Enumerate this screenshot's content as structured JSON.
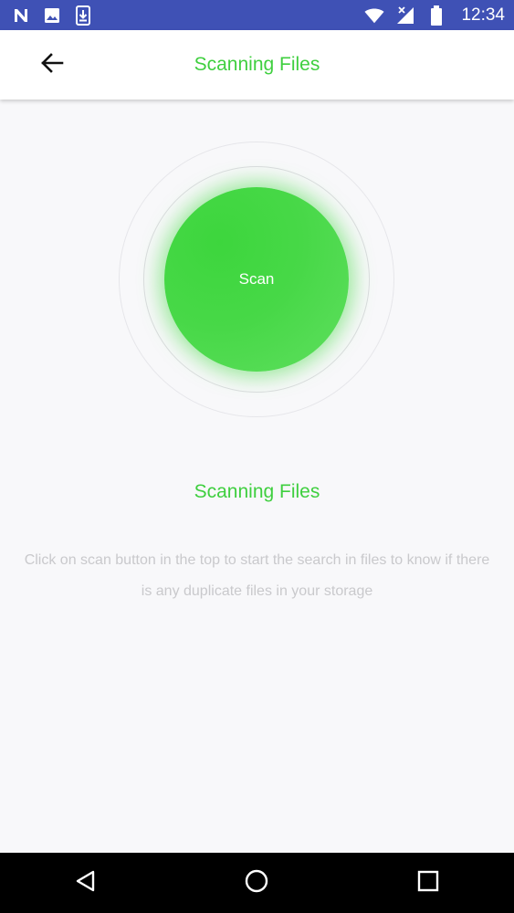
{
  "status_bar": {
    "time": "12:34",
    "icons": [
      "n-logo-icon",
      "image-icon",
      "download-icon",
      "wifi-icon",
      "signal-icon",
      "battery-icon"
    ]
  },
  "app_bar": {
    "title": "Scanning Files",
    "back_icon": "arrow-back-icon"
  },
  "scan": {
    "button_label": "Scan"
  },
  "main": {
    "title": "Scanning Files",
    "description": "Click on scan button in the top to start the search in files to know if there is any duplicate files in your storage"
  },
  "nav_bar": {
    "icons": [
      "back-triangle-icon",
      "home-circle-icon",
      "recents-square-icon"
    ]
  },
  "colors": {
    "status_bar": "#3f51b5",
    "accent": "#3fcf3f",
    "scan_button": "#47d847",
    "description_text": "#c9c9cc",
    "background": "#f8f8fa",
    "nav_bar": "#000000"
  }
}
